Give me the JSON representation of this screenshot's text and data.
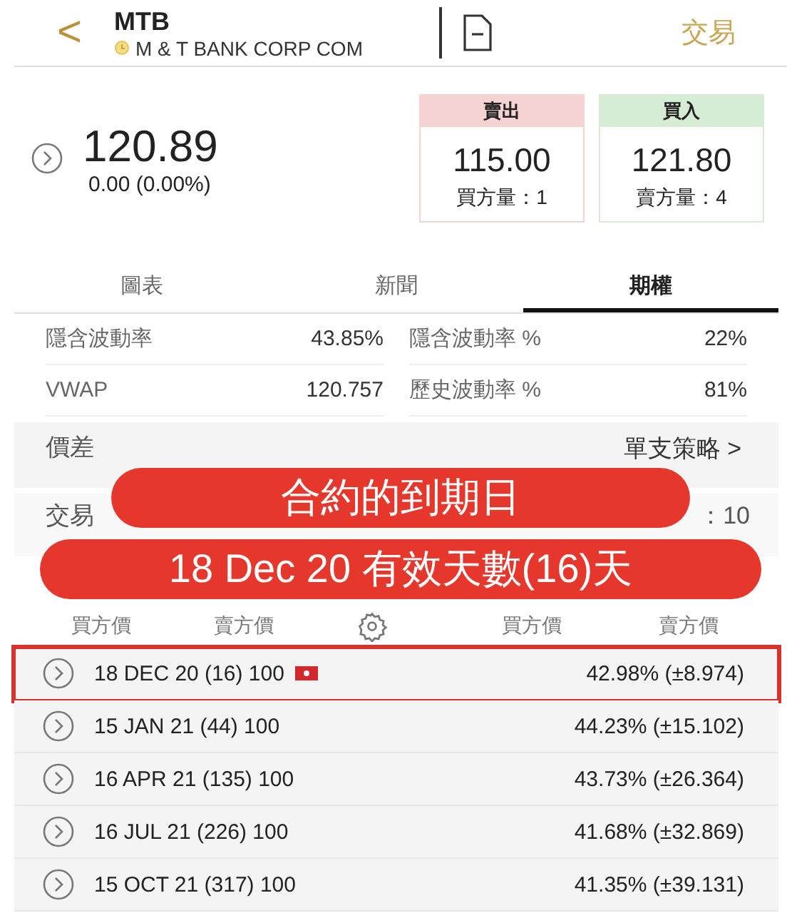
{
  "header": {
    "back": "<",
    "symbol": "MTB",
    "name": "M & T BANK CORP COM",
    "trade": "交易"
  },
  "quote": {
    "price": "120.89",
    "change": "0.00 (0.00%)",
    "boxes": [
      {
        "kind": "sell",
        "title": "賣出",
        "price": "115.00",
        "qty": "買方量：1"
      },
      {
        "kind": "buy",
        "title": "買入",
        "price": "121.80",
        "qty": "賣方量：4"
      }
    ]
  },
  "tabs": [
    {
      "label": "圖表",
      "selected": false
    },
    {
      "label": "新聞",
      "selected": false
    },
    {
      "label": "期權",
      "selected": true
    }
  ],
  "stats": [
    {
      "label": "隱含波動率",
      "value": "43.85%"
    },
    {
      "label": "隱含波動率 %",
      "value": "22%"
    },
    {
      "label": "VWAP",
      "value": "120.757"
    },
    {
      "label": "歷史波動率 %",
      "value": "81%"
    }
  ],
  "spread": {
    "label": "價差",
    "link": "單支策略 >"
  },
  "exchange": {
    "label": "交易",
    "value": "：10"
  },
  "callouts": [
    "合約的到期日",
    "18 Dec 20 有效天數(16)天"
  ],
  "columns": [
    "買方價",
    "賣方價",
    "買方價",
    "賣方價"
  ],
  "expiries": [
    {
      "label": "18 DEC 20 (16) 100",
      "iv": "42.98% (±8.974)",
      "highlighted": true,
      "flag": true
    },
    {
      "label": "15 JAN 21 (44) 100",
      "iv": "44.23% (±15.102)",
      "highlighted": false,
      "flag": false
    },
    {
      "label": "16 APR 21 (135) 100",
      "iv": "43.73% (±26.364)",
      "highlighted": false,
      "flag": false
    },
    {
      "label": "16 JUL 21 (226) 100",
      "iv": "41.68% (±32.869)",
      "highlighted": false,
      "flag": false
    },
    {
      "label": "15 OCT 21 (317) 100",
      "iv": "41.35% (±39.131)",
      "highlighted": false,
      "flag": false
    }
  ]
}
